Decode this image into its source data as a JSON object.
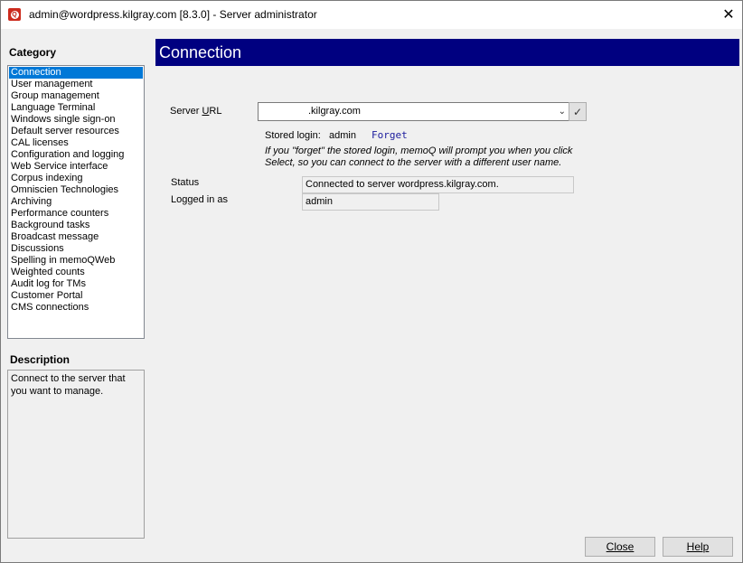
{
  "window": {
    "title": "admin@wordpress.kilgray.com [8.3.0] - Server administrator",
    "close_glyph": "✕"
  },
  "sidebar": {
    "category_heading": "Category",
    "items": [
      "Connection",
      "User management",
      "Group management",
      "Language Terminal",
      "Windows single sign-on",
      "Default server resources",
      "CAL licenses",
      "Configuration and logging",
      "Web Service interface",
      "Corpus indexing",
      "Omniscien Technologies",
      "Archiving",
      "Performance counters",
      "Background tasks",
      "Broadcast message",
      "Discussions",
      "Spelling in memoQWeb",
      "Weighted counts",
      "Audit log for TMs",
      "Customer Portal",
      "CMS connections"
    ],
    "selected_index": 0,
    "description_heading": "Description",
    "description_text": "Connect to the server that you want to manage."
  },
  "main": {
    "header": "Connection",
    "server_url_label": "Server URL",
    "server_url_value": ".kilgray.com",
    "check_glyph": "✓",
    "chevron_glyph": "⌄",
    "stored_login_label": "Stored login:",
    "stored_login_value": "admin",
    "forget_link": "Forget",
    "hint_text": "If you \"forget\" the stored login, memoQ will prompt you when you click Select, so you can connect to the server with a different user name.",
    "status_label": "Status",
    "status_value": "Connected to server wordpress.kilgray.com.",
    "logged_in_label": "Logged in as",
    "logged_in_value": "admin"
  },
  "footer": {
    "close_label": "Close",
    "help_label": "Help"
  },
  "colors": {
    "header_bg": "#000080",
    "selection_bg": "#0078d7"
  }
}
